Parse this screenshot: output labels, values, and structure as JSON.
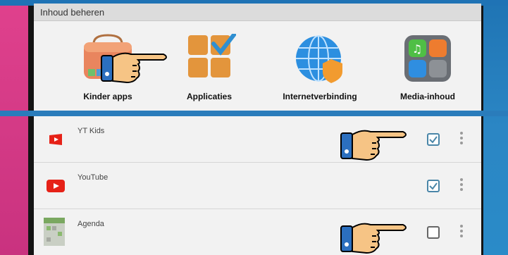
{
  "panel_header": "Inhoud beheren",
  "categories": [
    {
      "label": "Kinder apps",
      "icon": "shopping-bag-icon"
    },
    {
      "label": "Applicaties",
      "icon": "app-grid-checkmark-icon"
    },
    {
      "label": "Internetverbinding",
      "icon": "globe-shield-icon"
    },
    {
      "label": "Media-inhoud",
      "icon": "media-folder-icon"
    }
  ],
  "apps": [
    {
      "label": "YT Kids",
      "icon": "youtube-kids-icon",
      "checked": true
    },
    {
      "label": "YouTube",
      "icon": "youtube-icon",
      "checked": true
    },
    {
      "label": "Agenda",
      "icon": "calendar-icon",
      "checked": false
    }
  ],
  "colors": {
    "accent_blue": "#2a7cbb",
    "accent_pink": "#d63a87",
    "checkbox_checked": "#4a86a8",
    "youtube_red": "#e62117"
  }
}
